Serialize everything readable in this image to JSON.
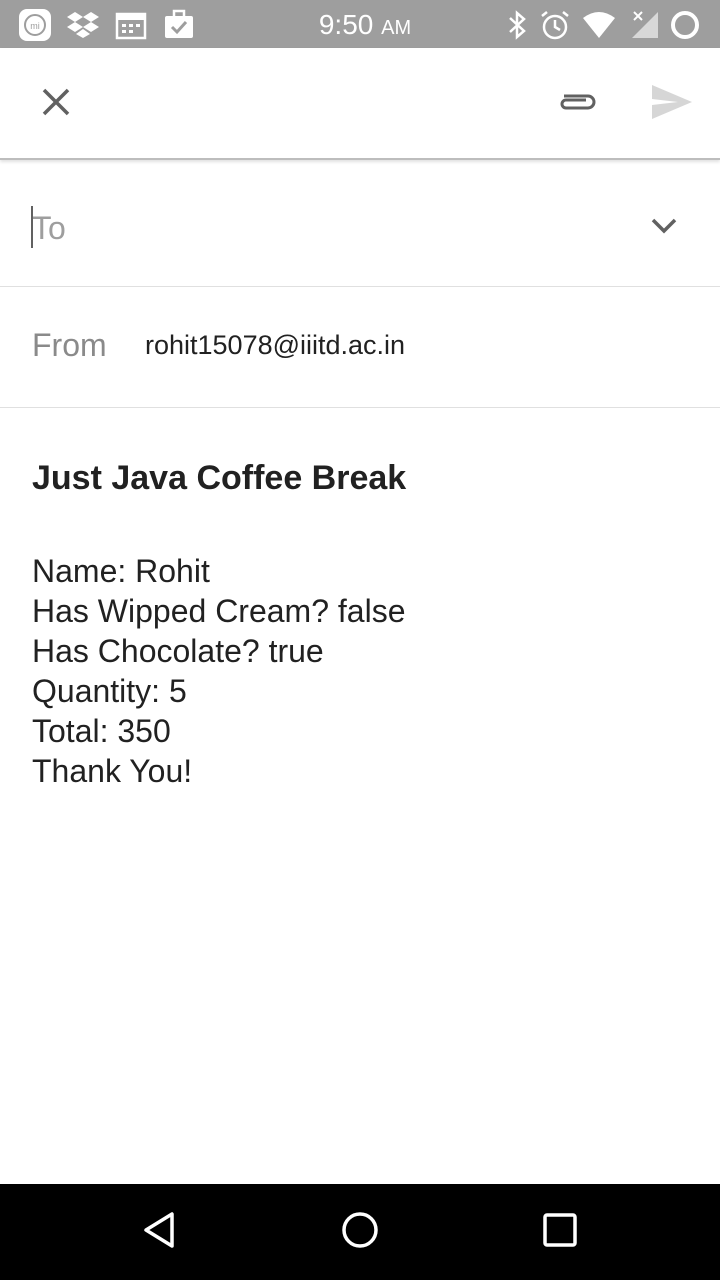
{
  "status_bar": {
    "time": "9:50",
    "ampm": "AM",
    "left_icons": [
      "mi-icon",
      "dropbox-icon",
      "calendar-icon",
      "task-icon"
    ],
    "right_icons": [
      "bluetooth-icon",
      "alarm-icon",
      "wifi-icon",
      "signal-icon",
      "battery-icon"
    ]
  },
  "toolbar": {
    "close_icon": "close-icon",
    "attach_icon": "paperclip-icon",
    "send_icon": "send-icon"
  },
  "compose": {
    "to_placeholder": "To",
    "from_label": "From",
    "from_value": "rohit15078@iiitd.ac.in",
    "subject": "Just Java Coffee Break",
    "body_lines": [
      "Name: Rohit",
      "Has Wipped Cream? false",
      "Has Chocolate? true",
      "Quantity: 5",
      "Total: 350",
      "Thank You!"
    ]
  },
  "colors": {
    "status_bar_bg": "#9e9e9e",
    "nav_bar_bg": "#000000",
    "text_primary": "#212121",
    "text_hint": "#9e9e9e"
  }
}
